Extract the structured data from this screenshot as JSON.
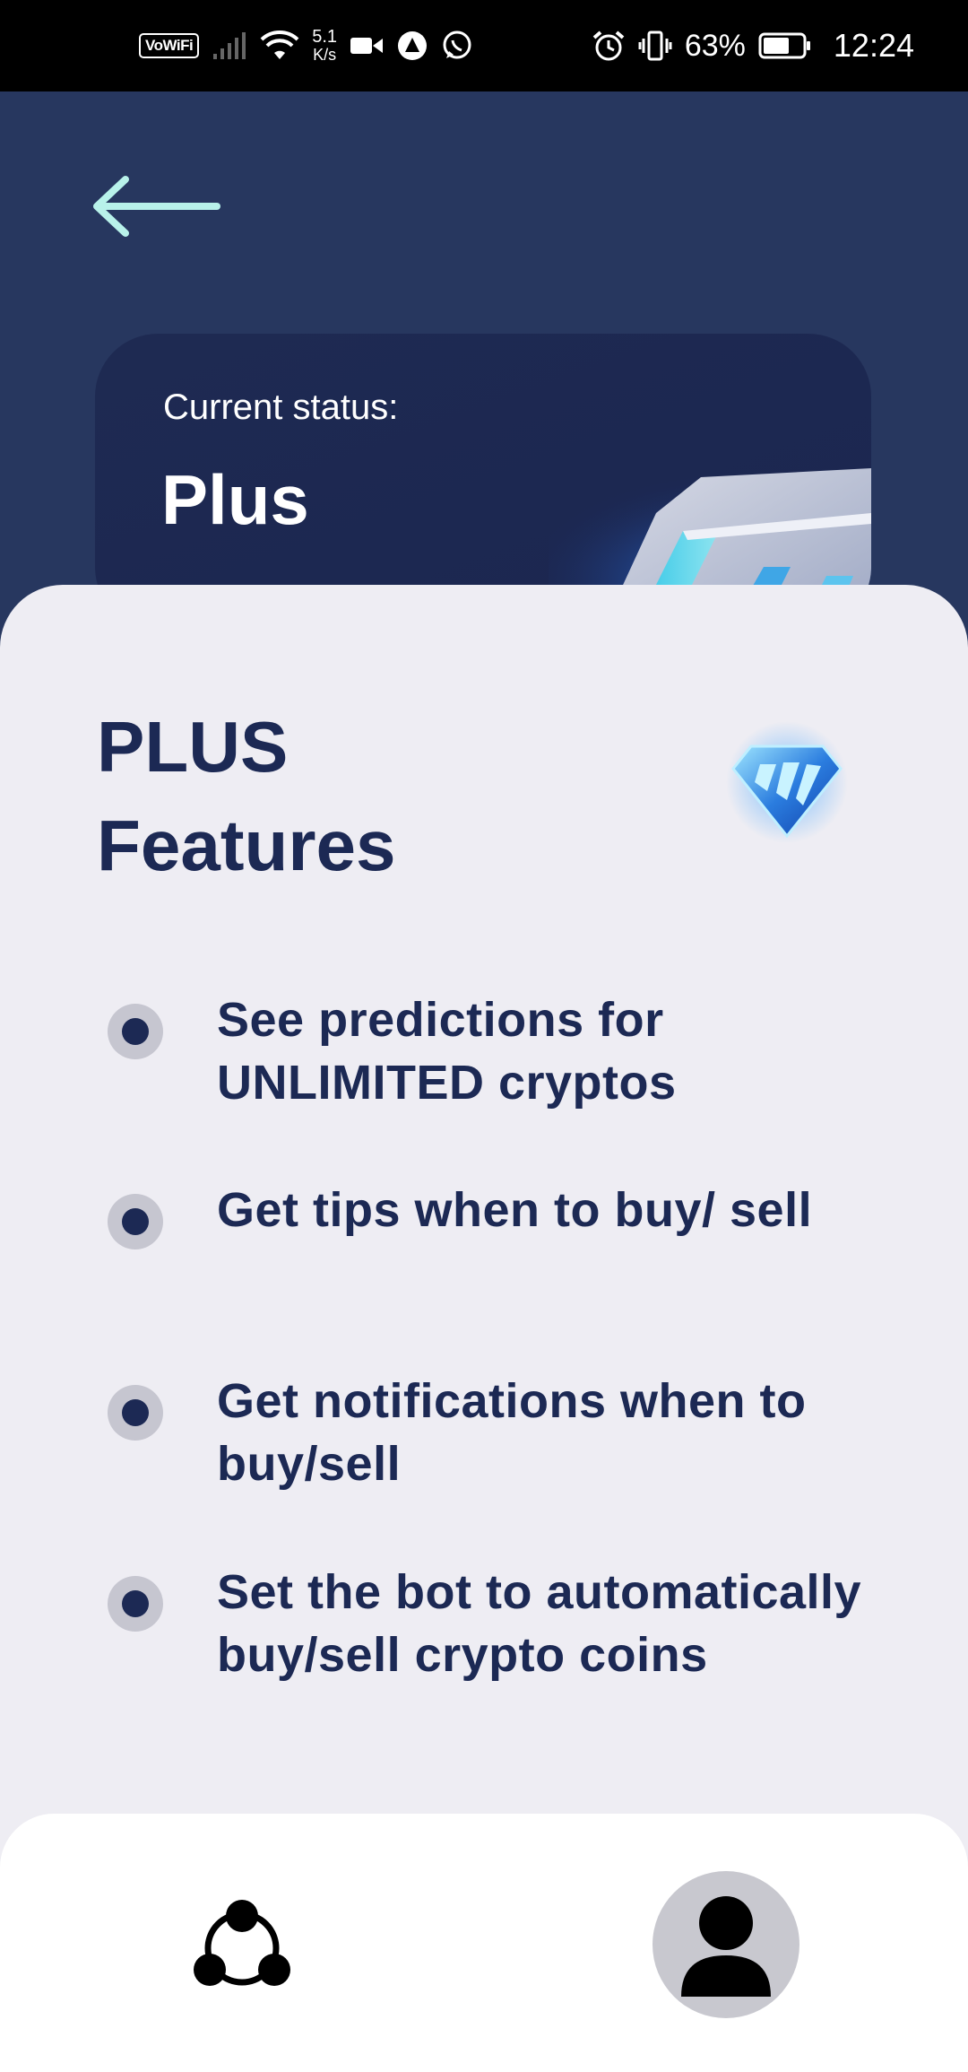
{
  "status_bar": {
    "vowifi": "VoWiFi",
    "speed_value": "5.1",
    "speed_unit": "K/s",
    "battery_percent": "63%",
    "time": "12:24"
  },
  "nav": {
    "back_icon": "arrow-left-icon"
  },
  "status_card": {
    "label": "Current status:",
    "value": "Plus"
  },
  "features_sheet": {
    "title_line1": "PLUS",
    "title_line2": "Features",
    "badge_icon": "diamond-icon",
    "items": [
      {
        "text": "See predictions for UNLIMITED cryptos"
      },
      {
        "text": "Get tips when to buy/ sell"
      },
      {
        "text": "Get notifications when to buy/sell"
      },
      {
        "text": "Set the bot to automatically buy/sell crypto coins"
      }
    ]
  },
  "bottom_nav": {
    "left_icon": "network-icon",
    "right_icon": "profile-icon"
  },
  "colors": {
    "background": "#27375f",
    "card": "#1e2a52",
    "sheet": "#eeedf3",
    "text_dark": "#1c2954",
    "accent_arrow": "#b8f2ea"
  }
}
